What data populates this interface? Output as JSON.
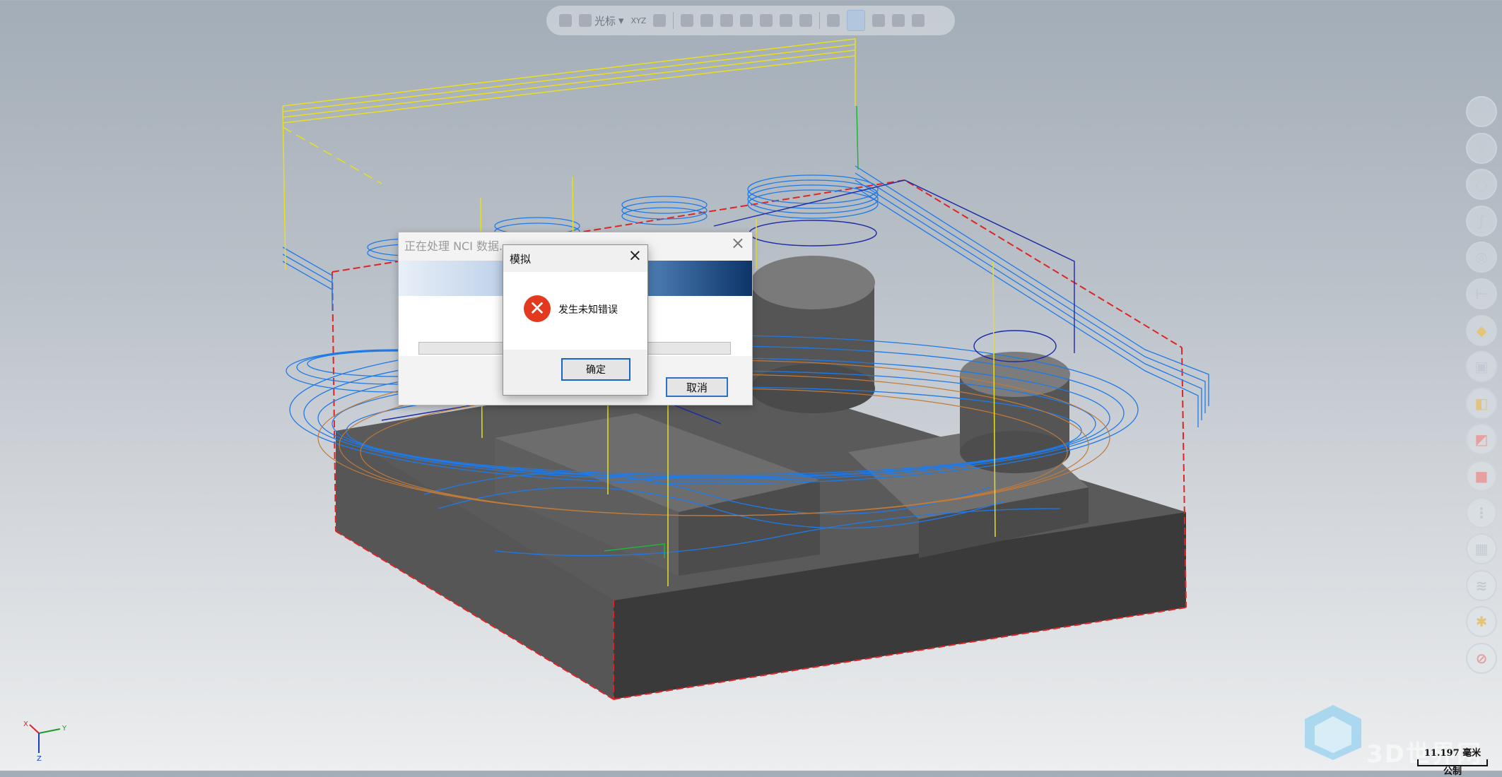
{
  "toolbar": {
    "cursor_label": "光标",
    "xyz_label": "XYZ"
  },
  "progress_dialog": {
    "title": "正在处理 NCI 数据...",
    "cancel_label": "取消"
  },
  "error_dialog": {
    "title": "模拟",
    "message": "发生未知错误",
    "ok_label": "确定"
  },
  "axis_triad": {
    "x": "X",
    "y": "Y",
    "z": "Z"
  },
  "watermark": {
    "text": "3D世界网"
  },
  "scale_bar": {
    "value": "11.197 毫米",
    "unit_system": "公制"
  },
  "rail_icons": [
    "add-icon",
    "axes-icon",
    "circle-icon",
    "curve-icon",
    "sphere-icon",
    "dimension-icon",
    "surface-icon",
    "solid-icon",
    "box-icon",
    "layer-color-icon",
    "red-cube-icon",
    "stack-icon",
    "grid-icon",
    "layers-icon",
    "settings-icon",
    "cancel-icon"
  ]
}
